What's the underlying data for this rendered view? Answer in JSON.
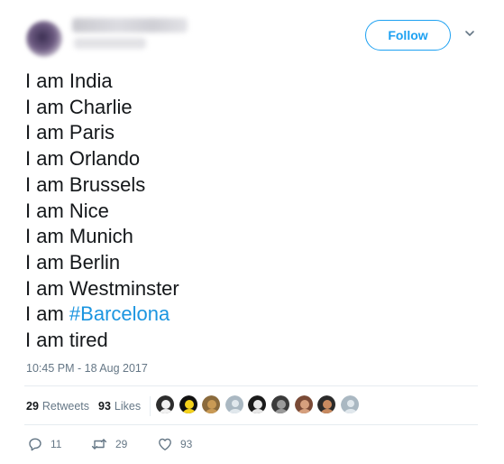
{
  "header": {
    "follow_label": "Follow",
    "caret_icon": "chevron-down-icon"
  },
  "tweet": {
    "lines": [
      "I am India",
      "I am Charlie",
      "I am Paris",
      "I am Orlando",
      "I am Brussels",
      "I am Nice",
      "I am Munich",
      "I am Berlin",
      "I am Westminster"
    ],
    "hashtag_prefix": "I am",
    "hashtag": "#Barcelona",
    "last_line": "I am tired",
    "timestamp": "10:45 PM - 18 Aug 2017"
  },
  "stats": {
    "retweets_count": "29",
    "retweets_label": "Retweets",
    "likes_count": "93",
    "likes_label": "Likes"
  },
  "likers": [
    {
      "kind": "photo",
      "bg": "#2d2d2d",
      "fg": "#f2f2f2"
    },
    {
      "kind": "photo",
      "bg": "#111111",
      "fg": "#f5d21c"
    },
    {
      "kind": "photo",
      "bg": "#8a6a3c",
      "fg": "#c99a55"
    },
    {
      "kind": "default",
      "bg": "#aab8c2",
      "fg": "#e1e8ed"
    },
    {
      "kind": "photo",
      "bg": "#1a1a1a",
      "fg": "#e8e8e8"
    },
    {
      "kind": "photo",
      "bg": "#3a3a3a",
      "fg": "#9a9a9a"
    },
    {
      "kind": "photo",
      "bg": "#7a4a36",
      "fg": "#d6a07e"
    },
    {
      "kind": "photo",
      "bg": "#2a2a2a",
      "fg": "#c88a60"
    },
    {
      "kind": "default",
      "bg": "#aab8c2",
      "fg": "#e1e8ed"
    }
  ],
  "actions": {
    "reply_count": "11",
    "retweet_count": "29",
    "like_count": "93"
  },
  "colors": {
    "accent": "#1da1f2",
    "hashtag": "#1b95e0",
    "muted": "#657786",
    "text": "#14171a"
  }
}
